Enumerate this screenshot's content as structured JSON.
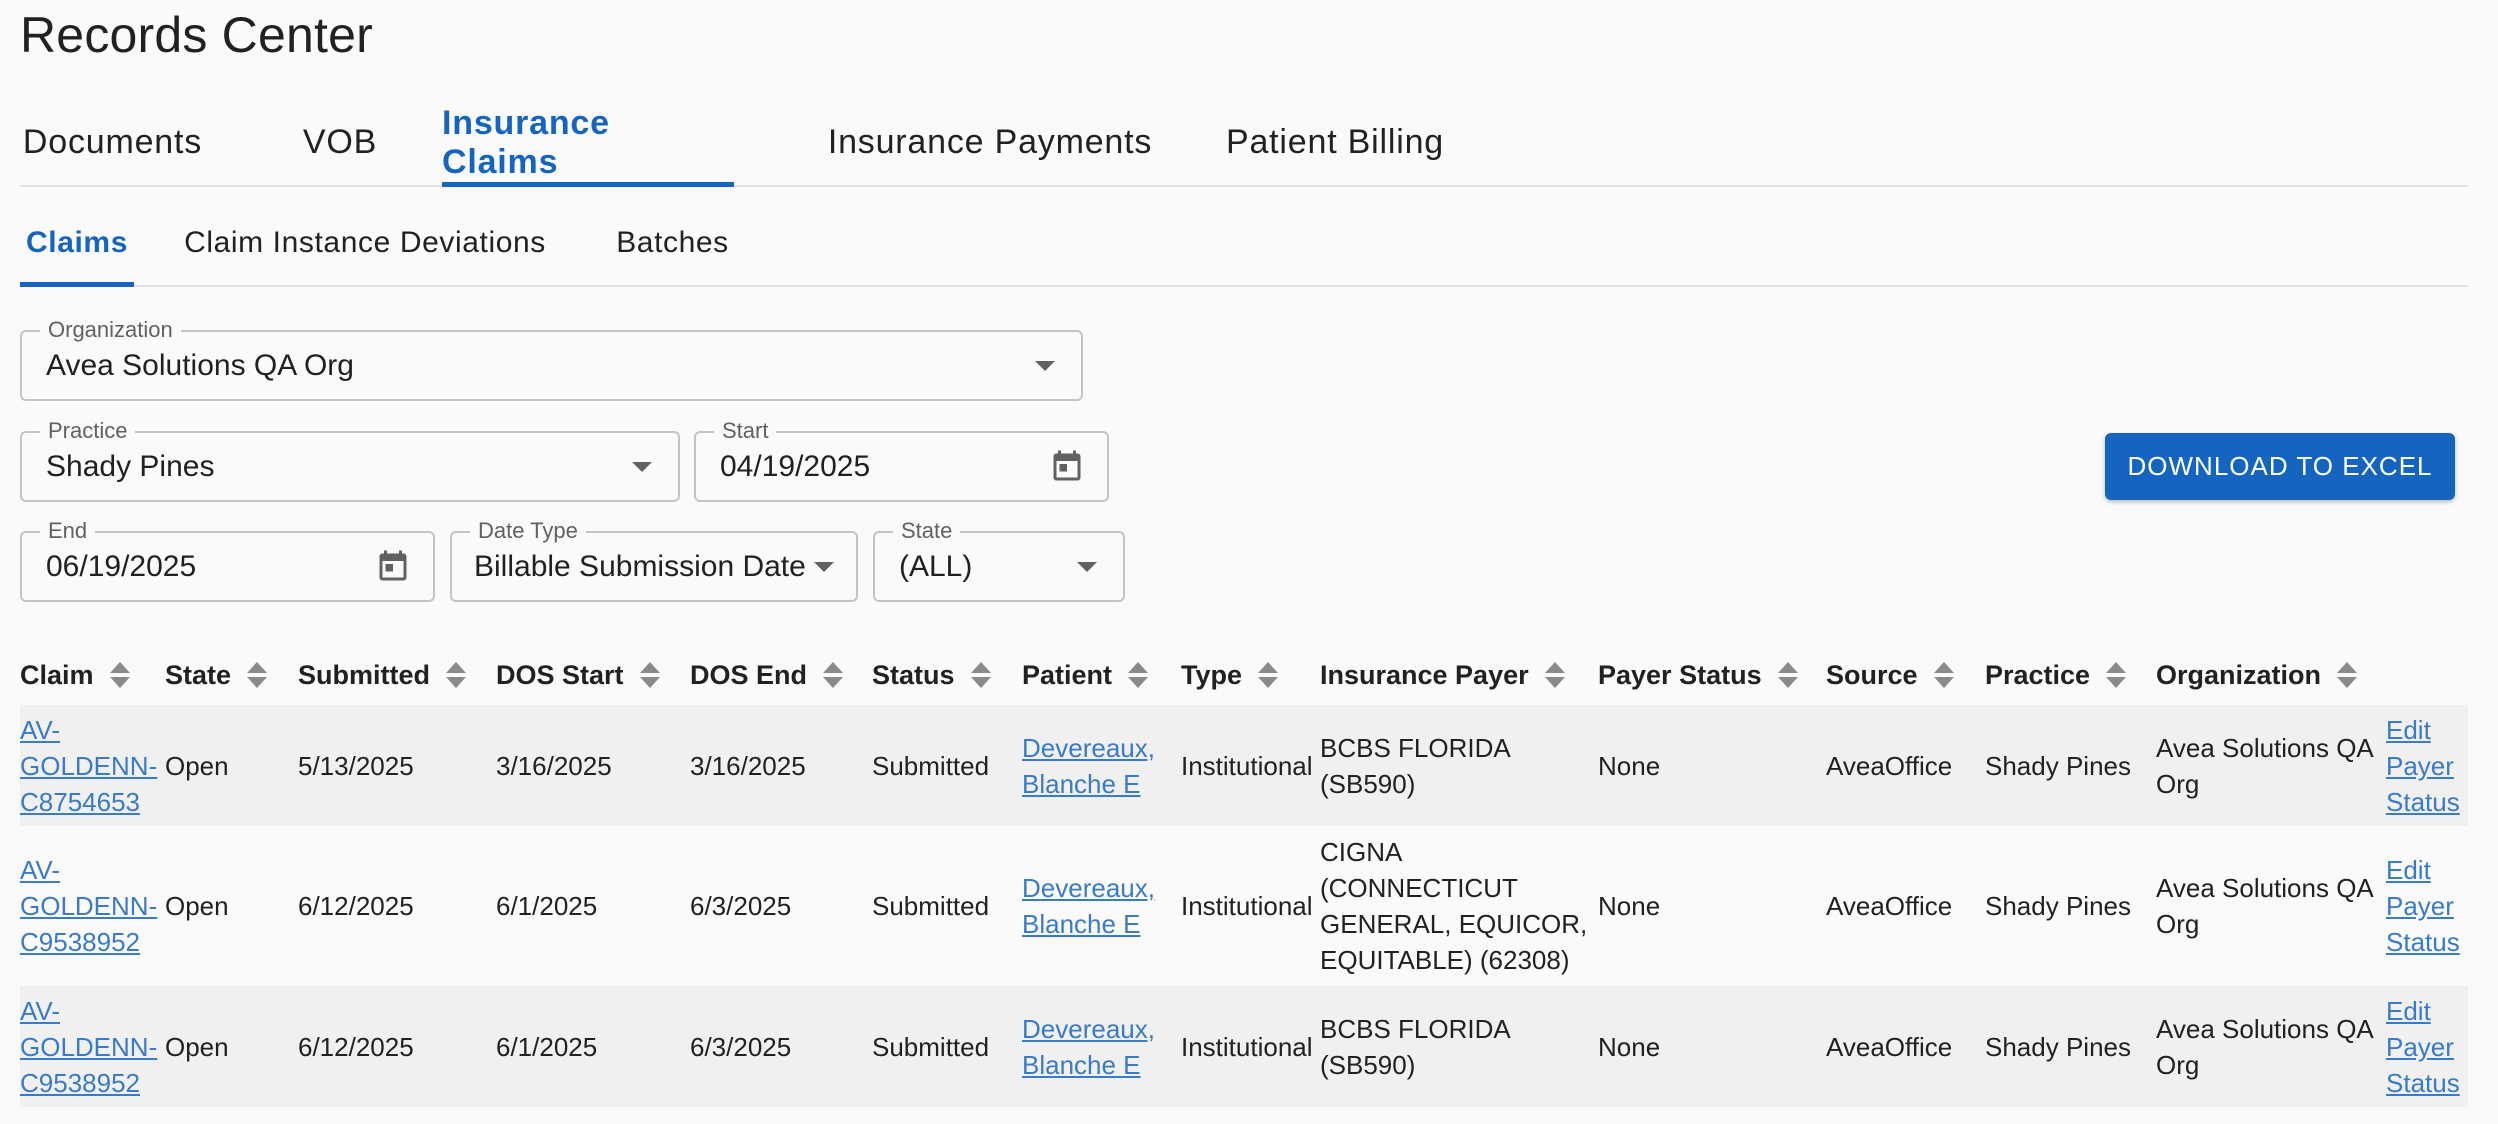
{
  "page_title": "Records Center",
  "main_tabs": [
    {
      "label": "Documents"
    },
    {
      "label": "VOB"
    },
    {
      "label": "Insurance Claims"
    },
    {
      "label": "Insurance Payments"
    },
    {
      "label": "Patient Billing"
    }
  ],
  "active_main_tab": "Insurance Claims",
  "sub_tabs": [
    {
      "label": "Claims"
    },
    {
      "label": "Claim Instance Deviations"
    },
    {
      "label": "Batches"
    }
  ],
  "active_sub_tab": "Claims",
  "filters": {
    "organization": {
      "label": "Organization",
      "value": "Avea Solutions QA Org"
    },
    "practice": {
      "label": "Practice",
      "value": "Shady Pines"
    },
    "start": {
      "label": "Start",
      "value": "04/19/2025"
    },
    "end": {
      "label": "End",
      "value": "06/19/2025"
    },
    "date_type": {
      "label": "Date Type",
      "value": "Billable Submission Date"
    },
    "state": {
      "label": "State",
      "value": "(ALL)"
    }
  },
  "download_button": "DOWNLOAD TO EXCEL",
  "colors": {
    "accent": "#1565c0",
    "link": "#3a7bc8"
  },
  "table": {
    "columns": [
      "Claim",
      "State",
      "Submitted",
      "DOS Start",
      "DOS End",
      "Status",
      "Patient",
      "Type",
      "Insurance Payer",
      "Payer Status",
      "Source",
      "Practice",
      "Organization"
    ],
    "rows": [
      {
        "claim": [
          "AV-",
          "GOLDENN-",
          "C8754653"
        ],
        "state": "Open",
        "submitted": "5/13/2025",
        "dos_start": "3/16/2025",
        "dos_end": "3/16/2025",
        "status": "Submitted",
        "patient": [
          "Devereaux,",
          "Blanche E"
        ],
        "type": "Institutional",
        "payer": [
          "BCBS FLORIDA",
          "(SB590)"
        ],
        "payer_status": "None",
        "source": "AveaOffice",
        "practice": "Shady Pines",
        "organization": [
          "Avea Solutions QA",
          "Org"
        ],
        "action": [
          "Edit",
          "Payer",
          "Status"
        ]
      },
      {
        "claim": [
          "AV-",
          "GOLDENN-",
          "C9538952"
        ],
        "state": "Open",
        "submitted": "6/12/2025",
        "dos_start": "6/1/2025",
        "dos_end": "6/3/2025",
        "status": "Submitted",
        "patient": [
          "Devereaux,",
          "Blanche E"
        ],
        "type": "Institutional",
        "payer": [
          "CIGNA",
          "(CONNECTICUT",
          "GENERAL, EQUICOR,",
          "EQUITABLE) (62308)"
        ],
        "payer_status": "None",
        "source": "AveaOffice",
        "practice": "Shady Pines",
        "organization": [
          "Avea Solutions QA",
          "Org"
        ],
        "action": [
          "Edit",
          "Payer",
          "Status"
        ]
      },
      {
        "claim": [
          "AV-",
          "GOLDENN-",
          "C9538952"
        ],
        "state": "Open",
        "submitted": "6/12/2025",
        "dos_start": "6/1/2025",
        "dos_end": "6/3/2025",
        "status": "Submitted",
        "patient": [
          "Devereaux,",
          "Blanche E"
        ],
        "type": "Institutional",
        "payer": [
          "BCBS FLORIDA",
          "(SB590)"
        ],
        "payer_status": "None",
        "source": "AveaOffice",
        "practice": "Shady Pines",
        "organization": [
          "Avea Solutions QA",
          "Org"
        ],
        "action": [
          "Edit",
          "Payer",
          "Status"
        ]
      }
    ]
  }
}
